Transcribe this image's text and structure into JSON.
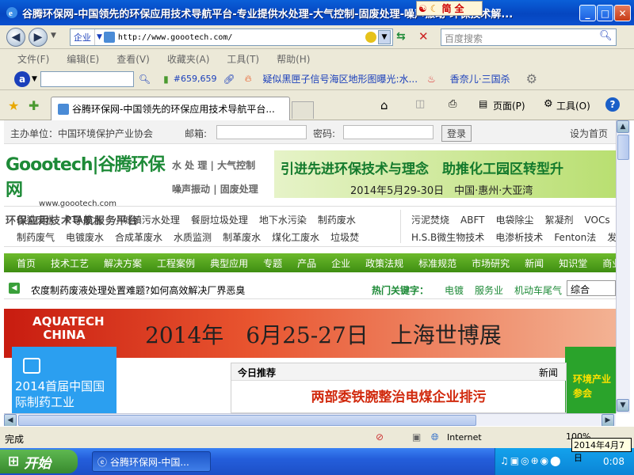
{
  "window": {
    "title": "谷腾环保网-中国领先的环保应用技术导航平台-专业提供水处理-大气控制-固废处理-噪声振动-环保技术解...",
    "ime": [
      "简",
      "全"
    ]
  },
  "address": {
    "zone_label": "企业",
    "url": "http://www.goootech.com/",
    "search_placeholder": "百度搜索"
  },
  "menu": [
    "文件(F)",
    "编辑(E)",
    "查看(V)",
    "收藏夹(A)",
    "工具(T)",
    "帮助(H)"
  ],
  "toolbar": {
    "count": "#659,659",
    "news": "疑似黑匣子信号海区地形图曝光:水...",
    "weather": "香奈儿·三国杀"
  },
  "tab": {
    "label": "谷腾环保网-中国领先的环保应用技术导航平台...",
    "page_label": "页面(P)",
    "tools_label": "工具(O)"
  },
  "site": {
    "host": "主办单位：中国环境保护产业协会",
    "email_label": "邮箱:",
    "password_label": "密码:",
    "login": "登录",
    "homepage": "设为首页",
    "logo_main": "Goootech|谷腾环保网",
    "logo_url": "www.goootech.com",
    "slogan": "环保应用技术导航服务平台",
    "subnav": [
      "水 处 理",
      "大气控制",
      "噪声振动",
      "固废处理"
    ],
    "banner_title": "引进先进环保技术与理念　助推化工园区转型升",
    "banner_date": "2014年5月29-30日　中国·惠州·大亚湾",
    "cats_row1": [
      "印染废水",
      "PTA废水",
      "小城镇污水处理",
      "餐厨垃圾处理",
      "地下水污染",
      "制药废水"
    ],
    "cats_row2": [
      "制药废气",
      "电镀废水",
      "合成革废水",
      "水质监测",
      "制革废水",
      "煤化工废水",
      "垃圾焚"
    ],
    "cats_right1": [
      "污泥焚烧",
      "ABFT",
      "电袋除尘",
      "絮凝剂",
      "VOCs"
    ],
    "cats_right2": [
      "H.S.B微生物技术",
      "电渗析技术",
      "Fenton法",
      "发"
    ],
    "green_nav": [
      "首页",
      "技术工艺",
      "解决方案",
      "工程案例",
      "典型应用",
      "专题",
      "产品",
      "企业",
      "政策法规",
      "标准规范",
      "市场研究",
      "新闻",
      "知识堂",
      "商业机会"
    ],
    "notice": "农度制药废液处理处置难题?如何高效解决厂界恶臭",
    "hot_label": "热门关键字：",
    "hot_keywords": [
      "电镀",
      "服务业",
      "机动车尾气"
    ],
    "select_value": "综合",
    "aquatech_brand": "AQUATECH CHINA",
    "aquatech_text": "2014年　6月25-27日　上海世博展",
    "pharma_ad": "2014首届中国国际制药工业",
    "env_ad": "环境产业参会",
    "today_label": "今日推荐",
    "news_label": "新闻",
    "headline": "两部委铁腕整治电煤企业排污"
  },
  "status": {
    "text": "完成",
    "zone": "Internet",
    "zoom": "100%"
  },
  "taskbar": {
    "start": "开始",
    "task": "谷腾环保网-中国...",
    "time": "0:08",
    "date_tip": "2014年4月7日"
  },
  "colors": {
    "accent_green": "#3e8e12",
    "headline_red": "#d12a0e",
    "xp_blue": "#245edb"
  }
}
